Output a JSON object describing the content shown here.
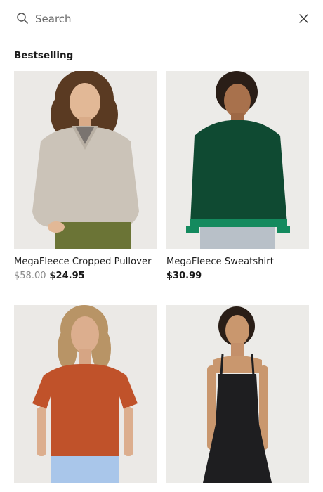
{
  "search": {
    "placeholder": "Search",
    "value": ""
  },
  "icons": {
    "search": "search-icon",
    "close": "close-icon"
  },
  "section": {
    "title": "Bestselling"
  },
  "products": [
    {
      "name": "MegaFleece Cropped Pullover",
      "original_price": "$58.00",
      "price": "$24.95"
    },
    {
      "name": "MegaFleece Sweatshirt",
      "original_price": "",
      "price": "$30.99"
    },
    {
      "name": "",
      "original_price": "",
      "price": ""
    },
    {
      "name": "",
      "original_price": "",
      "price": ""
    }
  ],
  "colors": {
    "text": "#1a1a1a",
    "muted": "#8a8a8a",
    "divider": "#d0d0d0",
    "pullover": "#cbc3b8",
    "sweatshirt": "#0f4a32",
    "tee": "#c0522a",
    "dress": "#1e1e20"
  }
}
